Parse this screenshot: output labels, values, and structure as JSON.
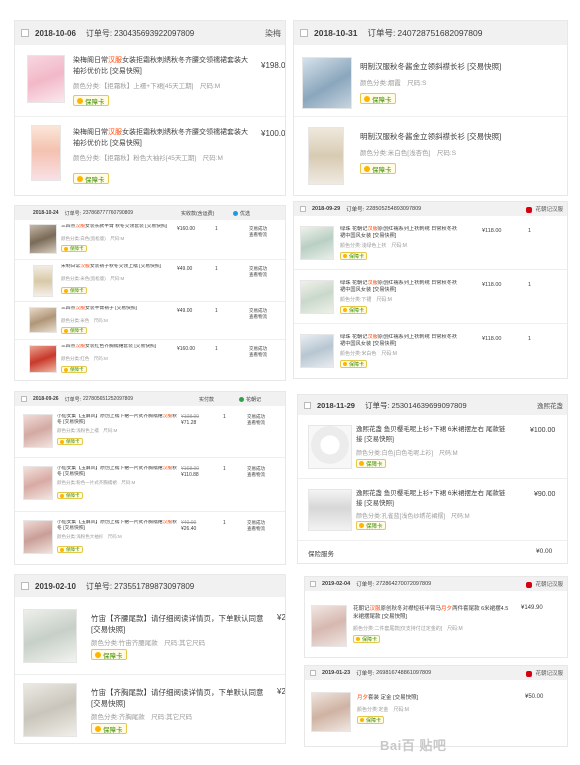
{
  "order_label": "订单号:",
  "badge_label": "保障卡",
  "p1": {
    "date": "2018-10-06",
    "order_no": "230435693922097809",
    "shop": "染梅",
    "items": [
      {
        "title_pre": "染梅阁日常",
        "title_hl": "汉服",
        "title_post": "女装拒霜秋刺绣秋冬齐腰交领襦裙套装大袖衫优价比 [交易快照]",
        "attr": "颜色分类:【拒霜秋】上襦+下裙[45天工期]　尺码:M",
        "price": "¥198.0"
      },
      {
        "title_pre": "染梅阁日常",
        "title_hl": "汉服",
        "title_post": "女装拒霜秋刺绣秋冬齐腰交领襦裙套装大袖衫优价比 [交易快照]",
        "attr": "颜色分类:【拒霜秋】粉色大袖衫[45天工期]　尺码:M",
        "price": "¥100.0"
      }
    ]
  },
  "p2": {
    "date": "2018-10-31",
    "order_no": "240728751682097809",
    "items": [
      {
        "title": "明制汉服秋冬酱金立领斜襟长衫 [交易快照]",
        "attr": "颜色分类:烟霞　尺码:S"
      },
      {
        "title": "明制汉服秋冬酱金立领斜襟长衫 [交易快照]",
        "attr": "颜色分类:米白色[浅杏色]　尺码:S"
      }
    ]
  },
  "p3": {
    "date": "2018-10-24",
    "order_no": "237868777760790809",
    "col1": "实收款(含运费)",
    "tag": "优选",
    "items": [
      {
        "title_pre": "三四点",
        "title_hl": "汉服",
        "title_post": "女装长款半臂 秋冬交领套装 [交易快照]",
        "attr": "颜色分类:白色(宽松版)　尺码:M",
        "price": "¥160.00",
        "qty": "1",
        "act": "交易成功\n查看物流"
      },
      {
        "title_pre": "宋制日常",
        "title_hl": "汉服",
        "title_post": "女装褙子秋冬交领上襦 [交易快照]",
        "attr": "颜色分类:米色(宽松版)　尺码:M",
        "price": "¥49.00",
        "qty": "1",
        "act": "交易成功\n查看物流"
      },
      {
        "title_pre": "三四点",
        "title_hl": "汉服",
        "title_post": "女装半臂褙子 [交易快照]",
        "attr": "颜色分类:米色　尺码:M",
        "price": "¥49.00",
        "qty": "1",
        "act": "交易成功\n查看物流"
      },
      {
        "title_pre": "三四点",
        "title_hl": "汉服",
        "title_post": "女装红色齐胸襦裙套装 [交易快照]",
        "attr": "颜色分类:红色　尺码:M",
        "price": "¥160.00",
        "qty": "1",
        "act": "交易成功\n查看物流"
      }
    ]
  },
  "p4": {
    "date": "2018-09-29",
    "order_no": "228505254893097809",
    "tag": "花朝记汉服",
    "items": [
      {
        "title_pre": "绿珠 花朝记",
        "title_hl": "汉服",
        "title_post": "原创红襦系列上袄刺绣 日常秋冬袄裙中国风女装 [交易快照]",
        "attr": "颜色分类:浅绿色上袄　尺码:M",
        "price": "¥118.00",
        "qty": "1"
      },
      {
        "title_pre": "绿珠 花朝记",
        "title_hl": "汉服",
        "title_post": "原创红襦系列上袄刺绣 日常秋冬袄裙中国风女装 [交易快照]",
        "attr": "颜色分类:下裙　尺码:M",
        "price": "¥118.00",
        "qty": "1"
      },
      {
        "title_pre": "绿珠 花朝记",
        "title_hl": "汉服",
        "title_post": "原创红襦系列上袄刺绣 日常秋冬袄裙中国风女装 [交易快照]",
        "attr": "颜色分类:米白色　尺码:M",
        "price": "¥118.00",
        "qty": "1"
      }
    ]
  },
  "p5": {
    "date": "2018-09-26",
    "order_no": "227805651252097809",
    "col1": "实付款",
    "tag": "花朝记",
    "items": [
      {
        "title_pre": "小仙女集【玉屏风】原创上襦下裙一片式齐胸襦裙",
        "title_hl": "汉服",
        "title_post": "秋冬 [交易快照]",
        "attr": "颜色分类:浅粉色上襦　尺码:M",
        "old": "¥108.00",
        "price": "¥71.28",
        "qty": "1",
        "act": "交易成功\n查看物流"
      },
      {
        "title_pre": "小仙女集【玉屏风】原创上襦下裙一片式齐胸襦裙",
        "title_hl": "汉服",
        "title_post": "秋冬 [交易快照]",
        "attr": "颜色分类:粉色一片式齐胸襦裙　尺码:M",
        "old": "¥168.00",
        "price": "¥110.88",
        "qty": "1",
        "act": "交易成功\n查看物流"
      },
      {
        "title_pre": "小仙女集【玉屏风】原创上襦下裙一片式齐胸襦裙",
        "title_hl": "汉服",
        "title_post": "秋冬 [交易快照]",
        "attr": "颜色分类:浅粉色大袖衫　尺码:M",
        "old": "¥40.00",
        "price": "¥26.40",
        "qty": "1",
        "act": "交易成功\n查看物流"
      }
    ]
  },
  "p6": {
    "date": "2018-11-29",
    "order_no": "253014639699097809",
    "shop": "逸熙花盏",
    "items": [
      {
        "title": "逸熙花盏 鱼贝樱毛呢上衫+下裙 6米裙摆左右 尾款链接 [交易快照]",
        "attr": "颜色分类:白色[白色毛呢上衫]　尺码:M",
        "price": "¥100.00"
      },
      {
        "title": "逸熙花盏 鱼贝樱毛呢上衫+下裙 6米裙摆左右 尾款链接 [交易快照]",
        "attr": "颜色分类:孔雀蓝[浅色纱绣花裙摆]　尺码:M",
        "price": "¥90.00"
      }
    ],
    "insurance_label": "保险服务",
    "insurance_price": "¥0.00"
  },
  "p7": {
    "date": "2019-02-04",
    "order_no": "272864270072097809",
    "tag": "花朝记汉服",
    "item": {
      "title_pre": "花朝记",
      "title_hl": "汉服",
      "title_mid": "原创秋冬对襟短袄半臂马",
      "title_hl2": "月夕",
      "title_post": "两件套尾款 6米裙摆4.5米裙摆尾款 [交易快照]",
      "attr": "颜色分类:二件套尾款[仅支持付过定金的]　尺码:M",
      "price": "¥149.90"
    }
  },
  "p8": {
    "date": "2019-02-10",
    "order_no": "273551789873097809",
    "items": [
      {
        "title": "竹宙【齐腰尾款】请仔细阅读详情页，下单默认同意 [交易快照]",
        "attr": "颜色分类:竹宙齐腰尾款　尺码:其它尺码",
        "price": "¥2"
      },
      {
        "title": "竹宙【齐胸尾款】请仔细阅读详情页，下单默认同意 [交易快照]",
        "attr": "颜色分类:齐胸尾款　尺码:其它尺码",
        "price": "¥2"
      }
    ]
  },
  "p9": {
    "date": "2019-01-23",
    "order_no": "269816748861097809",
    "tag": "花朝记汉服",
    "item": {
      "title_hl": "月夕",
      "title_post": "套装 定金 [交易快照]",
      "attr": "颜色分类:定金　尺码:M",
      "price": "¥50.00"
    }
  },
  "watermark": "Bai百 贴吧"
}
